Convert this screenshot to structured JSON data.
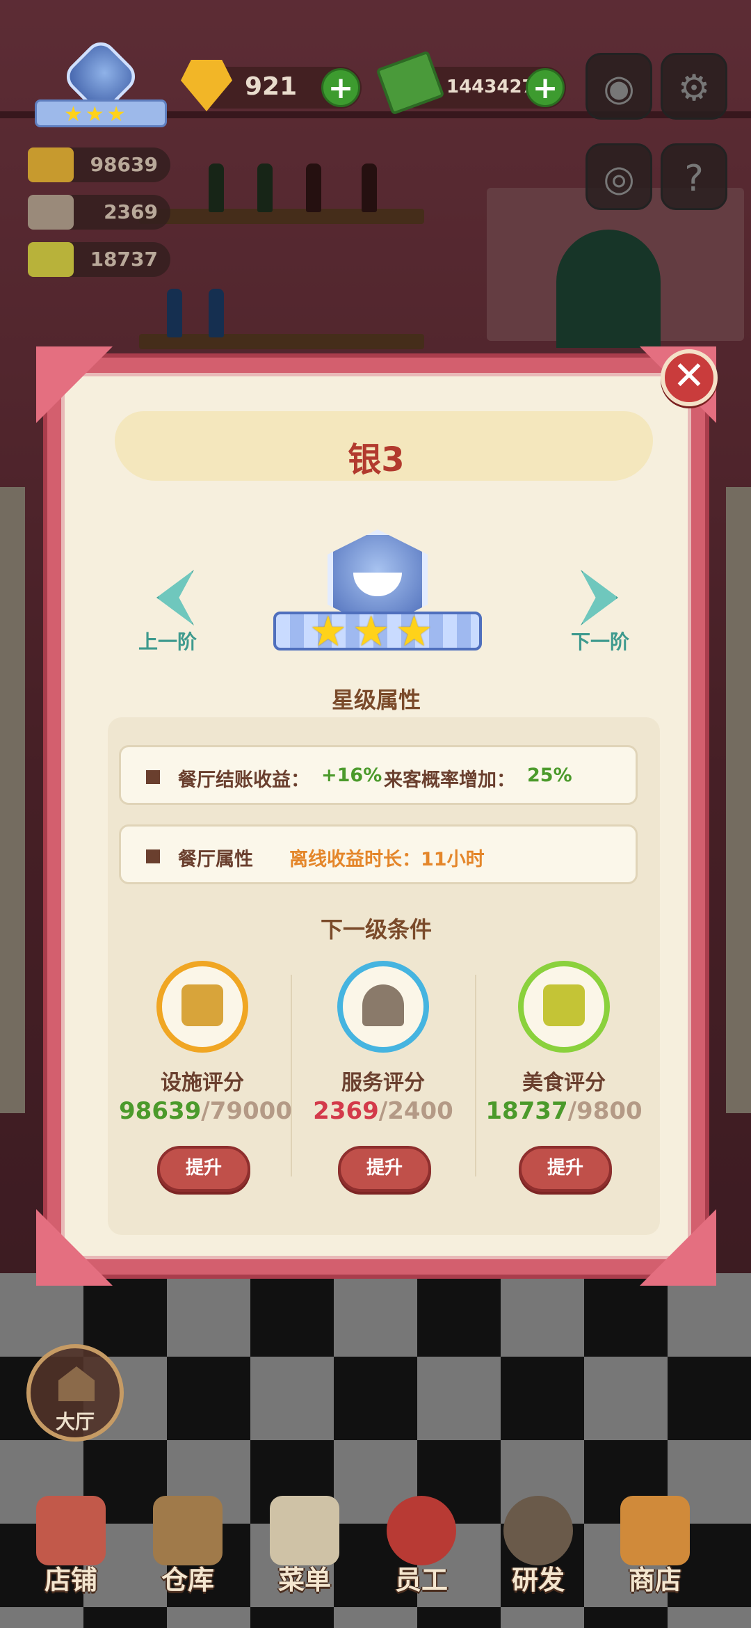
{
  "hud": {
    "gems": "921",
    "cash": "14434277",
    "plus_label": "+",
    "rank_stars": "★★★",
    "stats": [
      "98639",
      "2369",
      "18737"
    ]
  },
  "modal": {
    "title": "银3",
    "prev_label": "上一阶",
    "next_label": "下一阶",
    "emblem_stars": "★★★",
    "star_section": "星级属性",
    "attr1_label": "餐厅结账收益：",
    "attr1_value": "+16%",
    "attr1b_label": "来客概率增加：",
    "attr1b_value": "25%",
    "attr2_label": "餐厅属性",
    "attr2_value": "离线收益时长：11小时",
    "next_section": "下一级条件",
    "close_label": "✕",
    "conditions": [
      {
        "name": "设施评分",
        "current": "98639",
        "required": "/79000",
        "button": "提升",
        "color": "#f0a623"
      },
      {
        "name": "服务评分",
        "current": "2369",
        "required": "/2400",
        "button": "提升",
        "color": "#45b4e0"
      },
      {
        "name": "美食评分",
        "current": "18737",
        "required": "/9800",
        "button": "提升",
        "color": "#8ad13c"
      }
    ]
  },
  "hall_label": "大厅",
  "nav": [
    "店铺",
    "仓库",
    "菜单",
    "员工",
    "研发",
    "商店"
  ]
}
